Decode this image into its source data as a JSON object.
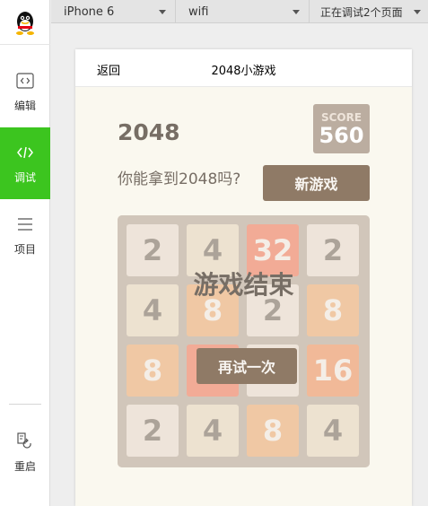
{
  "toolbar": {
    "device": "iPhone 6",
    "network": "wifi",
    "pages": "正在调试2个页面"
  },
  "sidebar": {
    "items": [
      {
        "label": "编辑",
        "icon": "code-icon"
      },
      {
        "label": "调试",
        "icon": "code-icon"
      },
      {
        "label": "项目",
        "icon": "menu-icon"
      },
      {
        "label": "重启",
        "icon": "restart-icon"
      }
    ],
    "active_color": "#3cc51f"
  },
  "phone": {
    "back": "返回",
    "title": "2048小游戏"
  },
  "game": {
    "title": "2048",
    "score_label": "SCORE",
    "score": "560",
    "tagline": "你能拿到2048吗?",
    "new_game": "新游戏",
    "over_text": "游戏结束",
    "retry": "再试一次",
    "tiles": [
      [
        "2",
        "4",
        "32",
        "2"
      ],
      [
        "4",
        "8",
        "2",
        "8"
      ],
      [
        "8",
        "",
        "",
        "16"
      ],
      [
        "2",
        "4",
        "8",
        "4"
      ]
    ]
  }
}
